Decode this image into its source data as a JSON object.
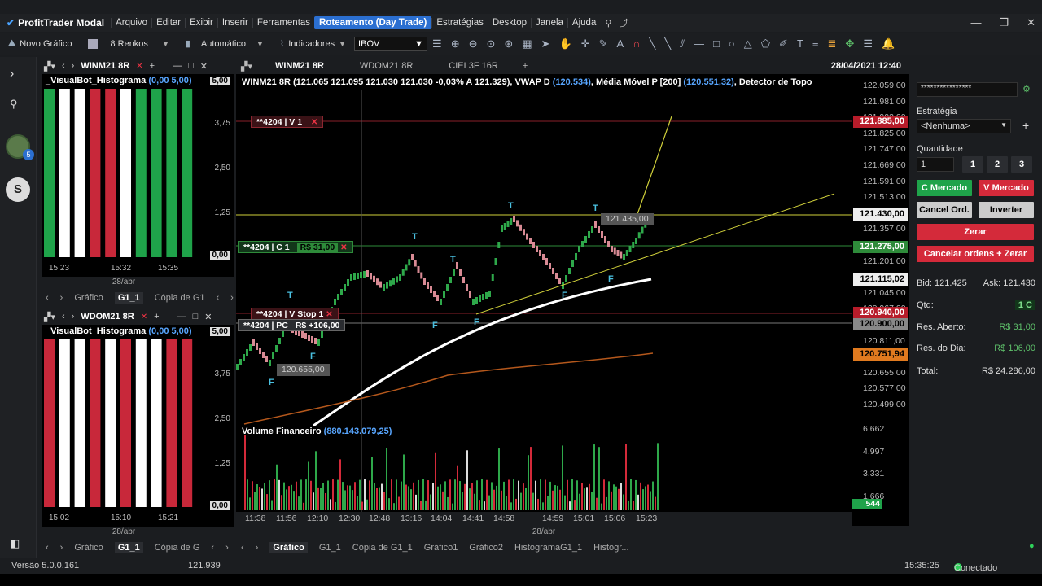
{
  "app": {
    "title": "ProfitTrader Modal"
  },
  "menu": [
    "Arquivo",
    "Editar",
    "Exibir",
    "Inserir",
    "Ferramentas",
    "Roteamento (Day Trade)",
    "Estratégias",
    "Desktop",
    "Janela",
    "Ajuda"
  ],
  "toolbar": {
    "new_chart": "Novo Gráfico",
    "renko": "8 Renkos",
    "auto": "Automático",
    "indicators": "Indicadores",
    "symbol": "IBOV"
  },
  "panel1": {
    "tab": "WINM21 8R",
    "title": "_VisualBot_Histograma",
    "values": "(0,00 5,00)",
    "yticks": [
      "5,00",
      "3,75",
      "2,50",
      "1,25",
      "0,00"
    ],
    "times": [
      "15:23",
      "15:32",
      "15:35"
    ],
    "date": "28/abr",
    "tabs": [
      "Gráfico",
      "G1_1",
      "Cópia de G1"
    ],
    "bars": [
      "green",
      "white",
      "white",
      "red",
      "red",
      "white",
      "green",
      "green",
      "green",
      "green"
    ]
  },
  "panel2": {
    "tab": "WDOM21 8R",
    "title": "_VisualBot_Histograma",
    "values": "(0,00 5,00)",
    "yticks": [
      "5,00",
      "3,75",
      "2,50",
      "1,25",
      "0,00"
    ],
    "times": [
      "15:02",
      "15:10",
      "15:21"
    ],
    "date": "28/abr",
    "tabs": [
      "Gráfico",
      "G1_1",
      "Cópia de G"
    ],
    "bars": [
      "red",
      "white",
      "white",
      "red",
      "white",
      "red",
      "white",
      "white",
      "red",
      "red"
    ]
  },
  "main": {
    "tabs": [
      "WINM21 8R",
      "WDOM21 8R",
      "CIEL3F 16R"
    ],
    "datetime": "28/04/2021 12:40",
    "legend_prefix": "WINM21 8R (121.065  121.095  121.030  121.030  -0,03%  A 121.329),  VWAP D ",
    "vwap": "(120.534)",
    "mm_label": ",  Média Móvel P [200] ",
    "mm": "(120.551,32)",
    "legend_suffix": ",  Detector de Topo",
    "prices": [
      "122.059,00",
      "121.981,00",
      "121.903,00",
      "121.825,00",
      "121.747,00",
      "121.669,00",
      "121.591,00",
      "121.513,00",
      "121.435,00",
      "121.357,00",
      "121.279,00",
      "121.201,00",
      "121.123,00",
      "121.045,00",
      "120.967,00",
      "120.889,00",
      "120.811,00",
      "120.733,00",
      "120.655,00",
      "120.577,00",
      "120.499,00"
    ],
    "tags": [
      {
        "v": "121.885,00",
        "bg": "#b71c2a",
        "fg": "#fff"
      },
      {
        "v": "121.430,00",
        "bg": "#eee",
        "fg": "#000"
      },
      {
        "v": "121.275,00",
        "bg": "#2e8b3a",
        "fg": "#fff"
      },
      {
        "v": "121.115,02",
        "bg": "#eee",
        "fg": "#000"
      },
      {
        "v": "120.940,00",
        "bg": "#b71c2a",
        "fg": "#fff"
      },
      {
        "v": "120.900,00",
        "bg": "#888",
        "fg": "#000"
      },
      {
        "v": "120.751,94",
        "bg": "#e07a1f",
        "fg": "#000"
      }
    ],
    "orders": {
      "v1": "**4204 | V 1",
      "c1": "**4204 | C 1",
      "c1_val": "R$ 31,00",
      "stop": "**4204 | V Stop 1",
      "pc": "**4204 | PC",
      "pc_val": "R$ +106,00"
    },
    "marks": {
      "p1": "121.435,00",
      "p2": "120.655,00"
    },
    "volume_label": "Volume Financeiro",
    "volume_value": "(880.143.079,25)",
    "vol_axis": [
      "6.662",
      "4.997",
      "3.331",
      "1.666"
    ],
    "vol_last": "544",
    "times": [
      "11:38",
      "11:56",
      "12:10",
      "12:30",
      "12:48",
      "13:16",
      "14:04",
      "14:41",
      "14:58",
      "14:59",
      "15:01",
      "15:06",
      "15:23"
    ],
    "date": "28/abr",
    "bottom_tabs": [
      "Gráfico",
      "G1_1",
      "Cópia de G1_1",
      "Gráfico1",
      "Gráfico2",
      "HistogramaG1_1",
      "Histogr..."
    ]
  },
  "right": {
    "strategy_label": "Estratégia",
    "strategy": "<Nenhuma>",
    "qty_label": "Quantidade",
    "qty": "1",
    "q1": "1",
    "q2": "2",
    "q3": "3",
    "buy": "C Mercado",
    "sell": "V Mercado",
    "cancel": "Cancel Ord.",
    "invert": "Inverter",
    "zero": "Zerar",
    "cancel_zero": "Cancelar ordens + Zerar",
    "bid": "Bid: 121.425",
    "ask": "Ask: 121.430",
    "qtd_label": "Qtd:",
    "qtd": "1 C",
    "open_label": "Res. Aberto:",
    "open": "R$ 31,00",
    "day_label": "Res. do Dia:",
    "day": "R$ 106,00",
    "total_label": "Total:",
    "total": "R$ 24.286,00",
    "masked": "****************"
  },
  "status": {
    "version": "Versão 5.0.0.161",
    "price": "121.939",
    "time": "15:35:25",
    "conn": "Conectado"
  },
  "colors": {
    "green": "#1fa34a",
    "red": "#c8283a",
    "white": "#ffffff",
    "route": "#2b6fd1"
  }
}
